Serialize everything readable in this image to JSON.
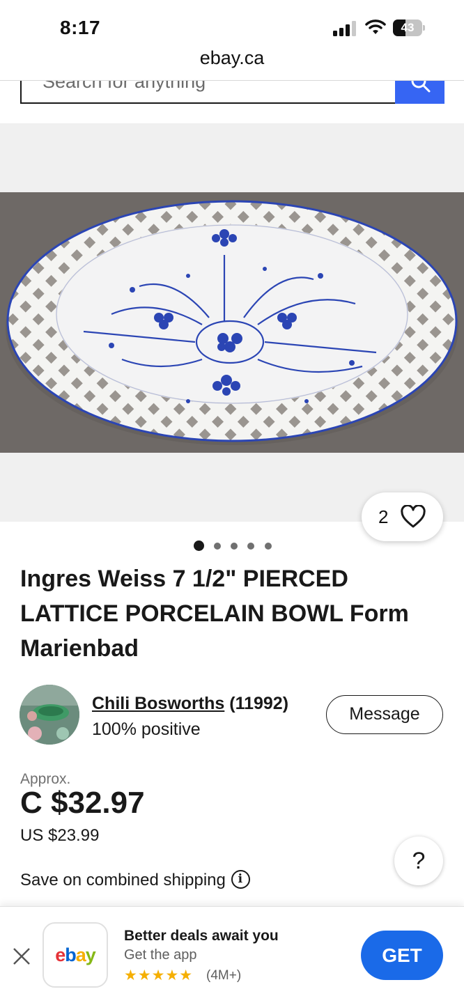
{
  "status_bar": {
    "time": "8:17",
    "battery_percent": "43"
  },
  "browser": {
    "url": "ebay.ca"
  },
  "search": {
    "placeholder": "Search for anything"
  },
  "gallery": {
    "favorites_count": "2",
    "image_count": 5,
    "active_index": 0
  },
  "listing": {
    "title": "Ingres Weiss 7 1/2\" PIERCED LATTICE PORCELAIN BOWL Form Marienbad"
  },
  "seller": {
    "name": "Chili Bosworths",
    "feedback_count": "(11992)",
    "positive": "100% positive",
    "message_button": "Message"
  },
  "price": {
    "approx_label": "Approx.",
    "cad": "C $32.97",
    "usd": "US $23.99"
  },
  "shipping": {
    "combined_label": "Save on combined shipping",
    "info_glyph": "i"
  },
  "help_button": "?",
  "app_banner": {
    "title": "Better deals await you",
    "subtitle": "Get the app",
    "stars": "★★★★★",
    "reviews": "(4M+)",
    "get_button": "GET",
    "logo": {
      "e": "e",
      "b": "b",
      "a": "a",
      "y": "y"
    }
  },
  "colors": {
    "ebay_blue": "#3665f3",
    "get_button_blue": "#1a6ae8",
    "star_yellow": "#f5af02",
    "bowl_blue": "#2b45b4"
  }
}
